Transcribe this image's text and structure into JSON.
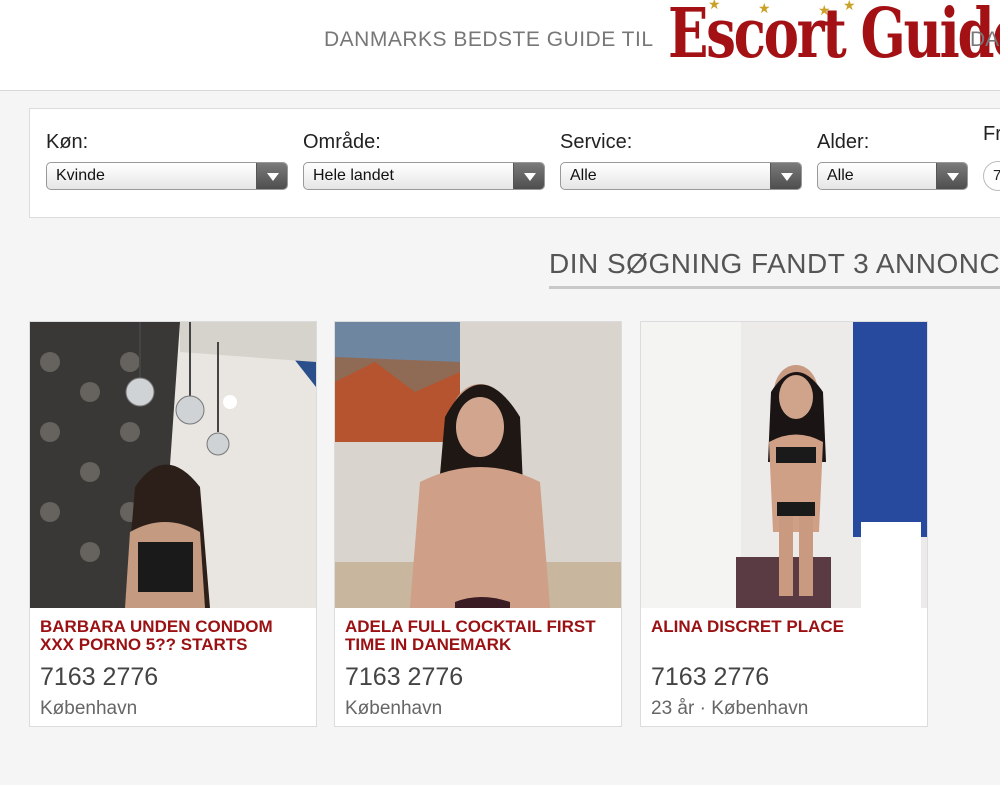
{
  "header": {
    "tagline": "DANMARKS BEDSTE GUIDE TIL",
    "tagline_cut": "DA",
    "logo_text": "Escort Guide"
  },
  "filters": {
    "gender": {
      "label": "Køn:",
      "value": "Kvinde"
    },
    "area": {
      "label": "Område:",
      "value": "Hele landet"
    },
    "service": {
      "label": "Service:",
      "value": "Alle"
    },
    "age": {
      "label": "Alder:",
      "value": "Alle"
    },
    "extra": {
      "label": "Fr",
      "value": "7"
    }
  },
  "results": {
    "text": "DIN SØGNING FANDT 3 ANNONC"
  },
  "colors": {
    "brand_red": "#a31115",
    "title_red": "#9b1113",
    "logo_star": "#c9a227"
  },
  "cards": [
    {
      "title": "BARBARA UNDEN CONDOM XXX PORNO 5?? STARTS",
      "phone": "7163 2776",
      "location": "København"
    },
    {
      "title": "ADELA FULL COCKTAIL FIRST TIME IN DANEMARK",
      "phone": "7163 2776",
      "location": "København"
    },
    {
      "title": "ALINA DISCRET PLACE",
      "phone": "7163 2776",
      "location": "23 år · København"
    }
  ]
}
